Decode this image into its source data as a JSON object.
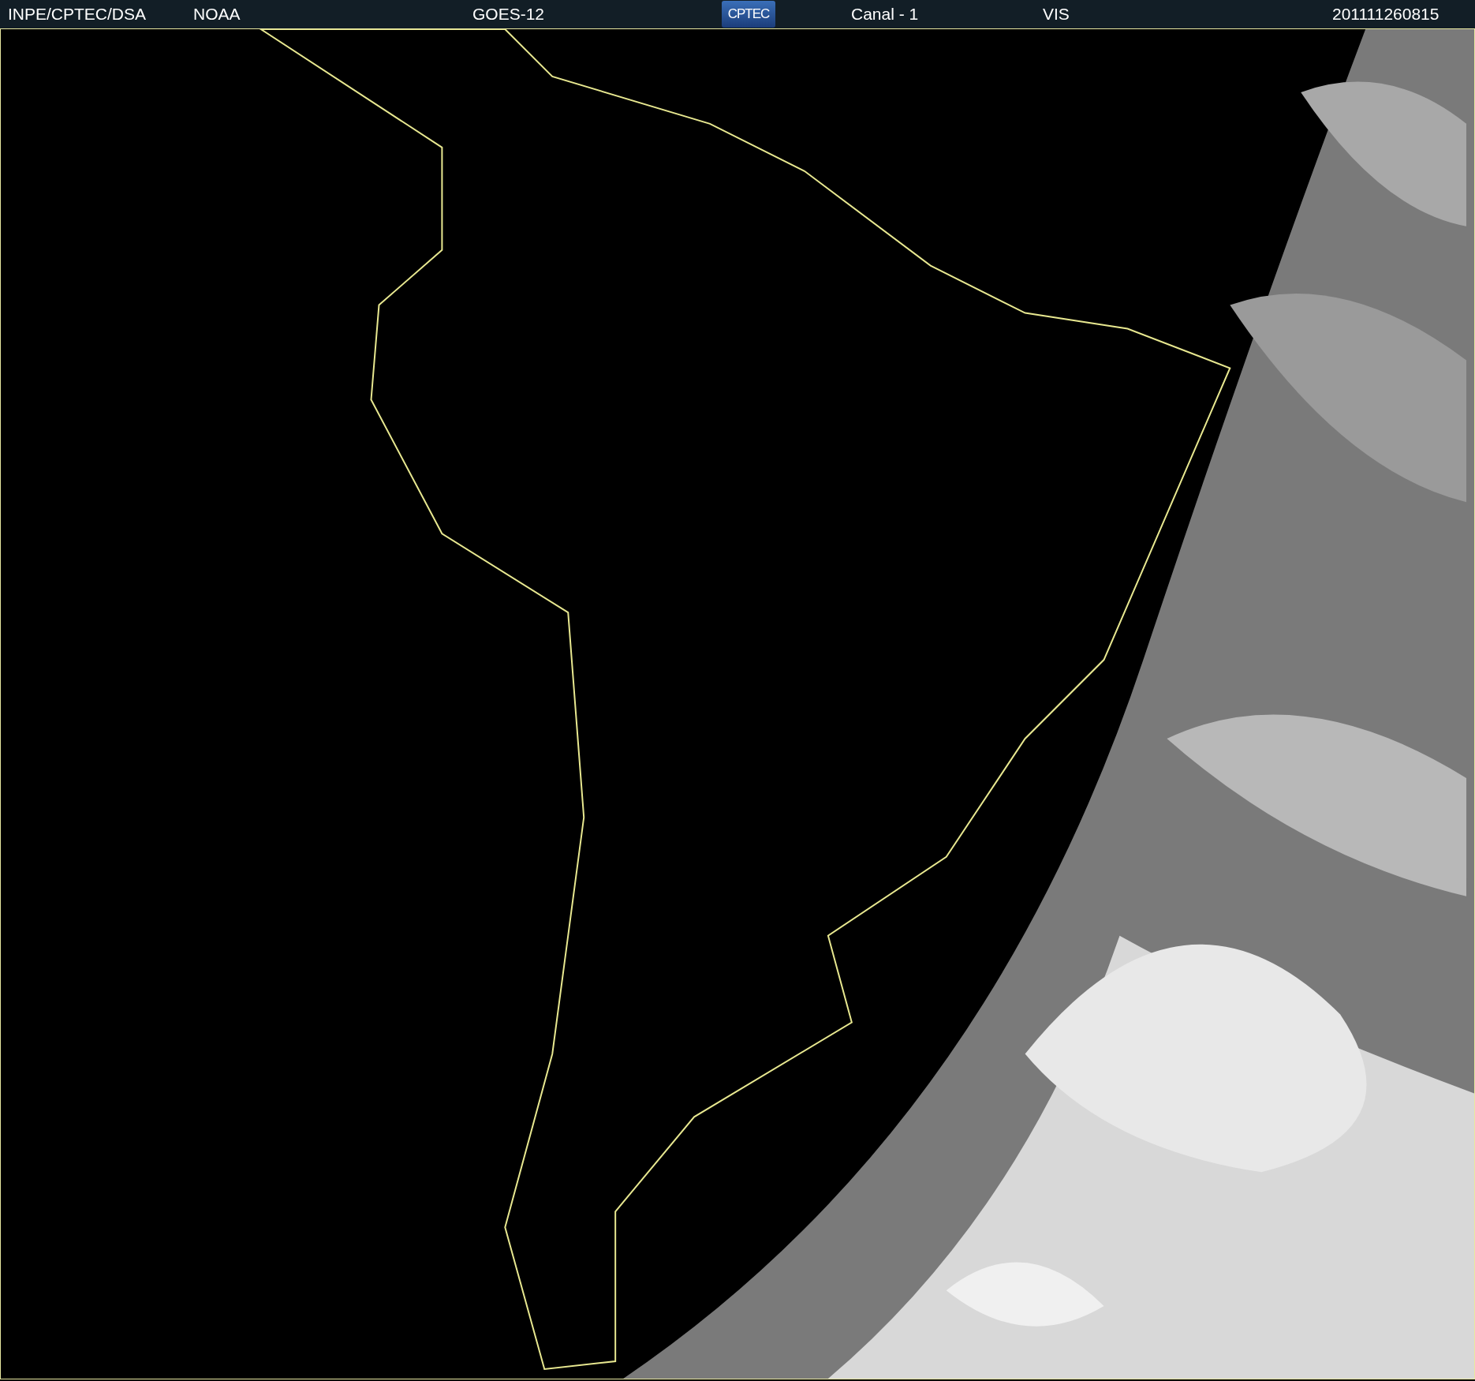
{
  "header": {
    "items": [
      {
        "kind": "text",
        "text": "INPE/CPTEC/DSA"
      },
      {
        "kind": "text",
        "text": "NOAA"
      },
      {
        "kind": "text",
        "text": "GOES-12"
      },
      {
        "kind": "logo",
        "text": "CPTEC"
      },
      {
        "kind": "text",
        "text": "Canal - 1"
      },
      {
        "kind": "text",
        "text": "VIS"
      },
      {
        "kind": "text",
        "text": "201111260815"
      }
    ]
  }
}
